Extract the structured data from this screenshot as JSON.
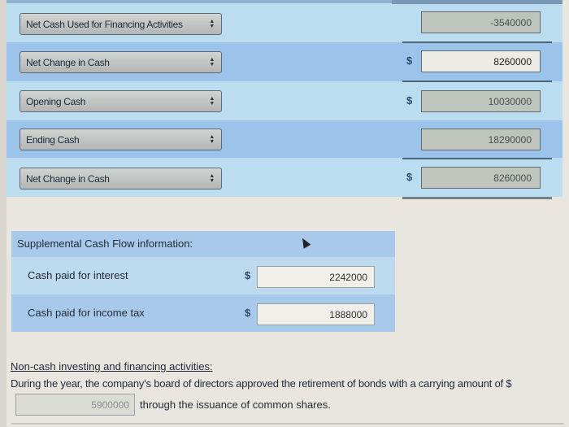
{
  "rows": [
    {
      "label": "Net Cash Used for Financing Activities",
      "currency": "",
      "value": "-3540000"
    },
    {
      "label": "Net Change in Cash",
      "currency": "$",
      "value": "8260000"
    },
    {
      "label": "Opening Cash",
      "currency": "$",
      "value": "10030000"
    },
    {
      "label": "Ending Cash",
      "currency": "",
      "value": "18290000"
    },
    {
      "label": "Net Change in Cash",
      "currency": "$",
      "value": "8260000"
    }
  ],
  "supplemental": {
    "title": "Supplemental Cash Flow information:",
    "items": [
      {
        "label": "Cash paid for interest",
        "currency": "$",
        "value": "2242000"
      },
      {
        "label": "Cash paid for income tax",
        "currency": "$",
        "value": "1888000"
      }
    ]
  },
  "noncash": {
    "title": "Non-cash investing and financing activities:",
    "text": "During the year, the company's board of directors approved the retirement of bonds with a carrying amount of $",
    "value": "5900000",
    "after_text": "through the issuance of common shares."
  },
  "icons": {
    "select_arrows": "▲▼"
  }
}
